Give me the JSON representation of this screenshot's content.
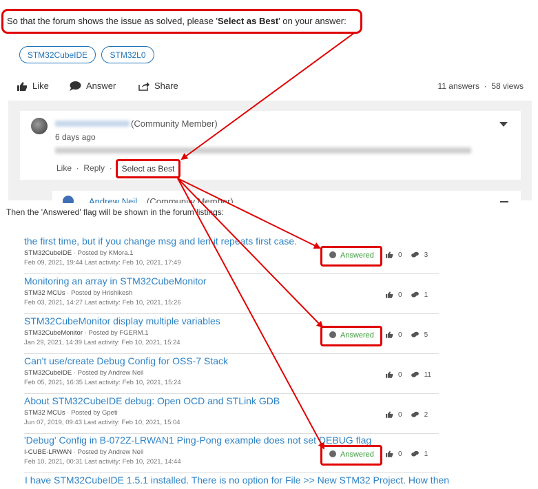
{
  "instruction": {
    "prefix": "So that the forum shows the issue as solved, please '",
    "emphasis": "Select as Best",
    "suffix": "' on your answer:"
  },
  "tags": [
    "STM32CubeIDE",
    "STM32L0"
  ],
  "actions": {
    "like": "Like",
    "answer": "Answer",
    "share": "Share"
  },
  "stats": {
    "answers": "11 answers",
    "views": "58 views"
  },
  "comment": {
    "member": "(Community Member)",
    "date": "6 days ago",
    "like": "Like",
    "reply": "Reply",
    "select_best": "Select as Best"
  },
  "reply_preview": {
    "name": "Andrew Neil",
    "member": "(Community Member)"
  },
  "then_text": "Then the 'Answered' flag will be shown in the forum listings:",
  "listing": [
    {
      "title": "the first time, but if you change msg and len it repeats first case.",
      "category": "STM32CubeIDE",
      "posted_by": "· Posted by  KMora.1",
      "dates": "Feb 09, 2021, 19:44    Last activity: Feb 10, 2021, 17:49",
      "answered": "Answered",
      "likes": "0",
      "answers": "3"
    },
    {
      "title": "Monitoring an array in STM32CubeMonitor",
      "category": "STM32 MCUs",
      "posted_by": "· Posted by  Hrishikesh",
      "dates": "Feb 03, 2021, 14:27    Last activity: Feb 10, 2021, 15:26",
      "answered": "",
      "likes": "0",
      "answers": "1"
    },
    {
      "title": "STM32CubeMonitor display multiple variables",
      "category": "STM32CubeMonitor",
      "posted_by": "· Posted by  FGERM.1",
      "dates": "Jan 29, 2021, 14:39    Last activity: Feb 10, 2021, 15:24",
      "answered": "Answered",
      "likes": "0",
      "answers": "5"
    },
    {
      "title": "Can't use/create Debug Config for OSS-7 Stack",
      "category": "STM32CubeIDE",
      "posted_by": "· Posted by  Andrew Neil",
      "dates": "Feb 05, 2021, 16:35    Last activity: Feb 10, 2021, 15:24",
      "answered": "",
      "likes": "0",
      "answers": "11"
    },
    {
      "title": "About STM32CubeIDE debug: Open OCD and STLink GDB",
      "category": "STM32 MCUs",
      "posted_by": "· Posted by  Gpeti",
      "dates": "Jun 07, 2019, 09:43    Last activity: Feb 10, 2021, 15:04",
      "answered": "",
      "likes": "0",
      "answers": "2"
    },
    {
      "title": "'Debug' Config in B-072Z-LRWAN1 Ping-Pong example does not set DEBUG flag",
      "category": "I-CUBE-LRWAN",
      "posted_by": "· Posted by  Andrew Neil",
      "dates": "Feb 10, 2021, 00:31    Last activity: Feb 10, 2021, 14:44",
      "answered": "Answered",
      "likes": "0",
      "answers": "1"
    }
  ],
  "cut_title": "I have STM32CubeIDE 1.5.1 installed. There is no option for File >> New STM32 Project. How then",
  "colors": {
    "annotation": "#e00000",
    "link": "#2e83c6",
    "answered": "#3b9c3b",
    "tag": "#1f74b8"
  }
}
